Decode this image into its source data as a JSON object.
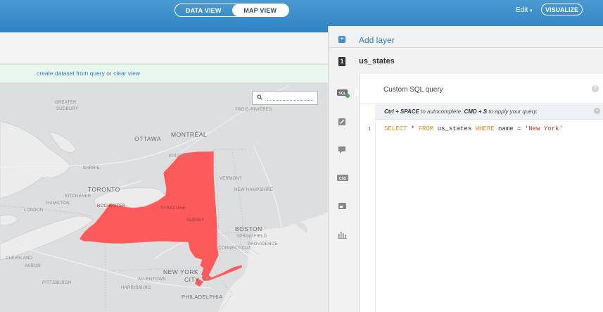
{
  "topbar": {
    "view_toggle": {
      "data_view": "DATA VIEW",
      "map_view": "MAP VIEW",
      "active": "MAP VIEW"
    },
    "edit_label": "Edit",
    "edit_caret": "▾",
    "visualize_label": "VISUALIZE"
  },
  "notice": {
    "link1": "create dataset from query",
    "middle": " or ",
    "link2": "clear view"
  },
  "map": {
    "labels": {
      "greater_sudbury_1": "GREATER",
      "greater_sudbury_2": "SUDBURY",
      "trois_rivieres": "TROIS-RIVIÈRES",
      "ottawa": "OTTAWA",
      "montreal": "MONTRÉAL",
      "barrie": "BARRIE",
      "kingston": "KINGSTON",
      "toronto": "TORONTO",
      "kitchener": "KITCHENER",
      "hamilton": "HAMILTON",
      "london": "LONDON",
      "rochester": "ROCHESTER",
      "syracuse": "SYRACUSE",
      "vermont": "VERMONT",
      "new_hampshire": "NEW HAMPSHIRE",
      "albany": "ALBANY",
      "boston": "BOSTON",
      "springfield": "SPRINGFIELD",
      "providence": "PROVIDENCE",
      "connecticut": "CONNECTICUT",
      "cleveland": "CLEVELAND",
      "akron": "AKRON",
      "pittsburgh": "PITTSBURGH",
      "allentown": "ALLENTOWN",
      "harrisburg": "HARRISBURG",
      "philadelphia": "PHILADELPHIA",
      "new_york_1": "NEW YORK",
      "new_york_2": "CITY"
    },
    "highlight_color": "#fd5b5b"
  },
  "panel": {
    "add_layer_label": "Add layer",
    "add_icon": "+",
    "layer_number": "1",
    "layer_name": "us_states",
    "tools": [
      "sql-icon",
      "wizard-icon",
      "infowindow-icon",
      "css-icon",
      "legend-icon",
      "filters-icon"
    ],
    "sql_tool_label": "SQL",
    "css_tool_label": "CSS",
    "editor": {
      "title": "Custom SQL query",
      "help": "?",
      "hint_key1": "Ctrl + SPACE",
      "hint_mid": " to autocomplete. ",
      "hint_key2": "CMD + S",
      "hint_end": " to apply your query.",
      "hint_close": "×",
      "line_number": "1",
      "code": {
        "kw1": "SELECT",
        "p1": " * ",
        "kw2": "FROM",
        "p2": " us_states ",
        "kw3": "WHERE",
        "p3": " name = ",
        "str": "'New York'"
      }
    }
  }
}
